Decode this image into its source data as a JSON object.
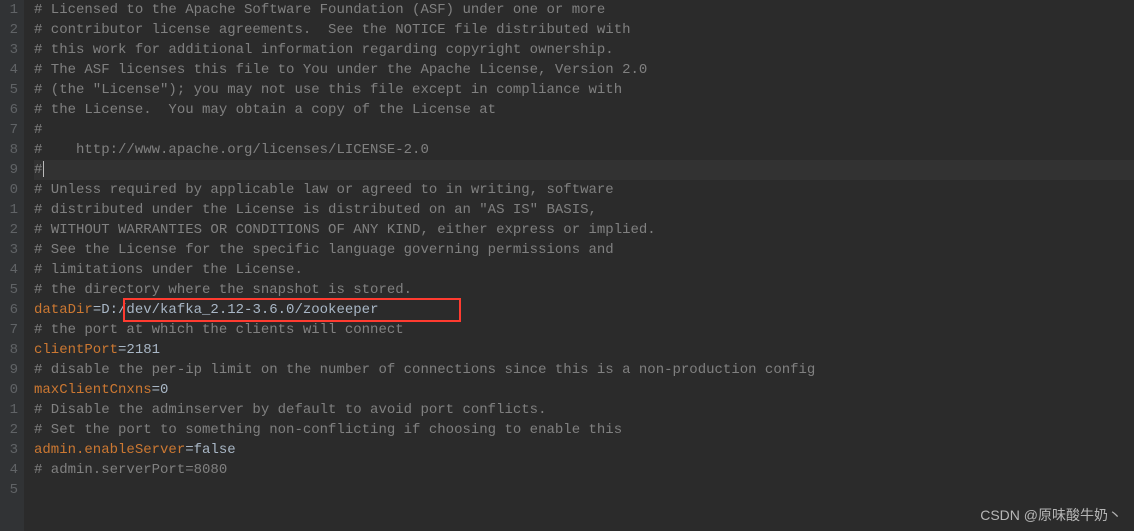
{
  "gutter": [
    "1",
    "2",
    "3",
    "4",
    "5",
    "6",
    "7",
    "8",
    "9",
    "0",
    "1",
    "2",
    "3",
    "4",
    "5",
    "6",
    "7",
    "8",
    "9",
    "0",
    "1",
    "2",
    "3",
    "4",
    "5"
  ],
  "lines": [
    {
      "type": "comment",
      "text": "# Licensed to the Apache Software Foundation (ASF) under one or more"
    },
    {
      "type": "comment",
      "text": "# contributor license agreements.  See the NOTICE file distributed with"
    },
    {
      "type": "comment",
      "text": "# this work for additional information regarding copyright ownership."
    },
    {
      "type": "comment",
      "text": "# The ASF licenses this file to You under the Apache License, Version 2.0"
    },
    {
      "type": "comment",
      "text": "# (the \"License\"); you may not use this file except in compliance with"
    },
    {
      "type": "comment",
      "text": "# the License.  You may obtain a copy of the License at"
    },
    {
      "type": "comment",
      "text": "#"
    },
    {
      "type": "comment",
      "text": "#    http://www.apache.org/licenses/LICENSE-2.0"
    },
    {
      "type": "comment",
      "text": "#",
      "current": true
    },
    {
      "type": "comment",
      "text": "# Unless required by applicable law or agreed to in writing, software"
    },
    {
      "type": "comment",
      "text": "# distributed under the License is distributed on an \"AS IS\" BASIS,"
    },
    {
      "type": "comment",
      "text": "# WITHOUT WARRANTIES OR CONDITIONS OF ANY KIND, either express or implied."
    },
    {
      "type": "comment",
      "text": "# See the License for the specific language governing permissions and"
    },
    {
      "type": "comment",
      "text": "# limitations under the License."
    },
    {
      "type": "comment",
      "text": "# the directory where the snapshot is stored."
    },
    {
      "type": "kv",
      "key": "dataDir",
      "value": "D:/dev/kafka_2.12-3.6.0/zookeeper"
    },
    {
      "type": "comment",
      "text": "# the port at which the clients will connect"
    },
    {
      "type": "kv",
      "key": "clientPort",
      "value": "2181"
    },
    {
      "type": "comment",
      "text": "# disable the per-ip limit on the number of connections since this is a non-production config"
    },
    {
      "type": "kv",
      "key": "maxClientCnxns",
      "value": "0"
    },
    {
      "type": "comment",
      "text": "# Disable the adminserver by default to avoid port conflicts."
    },
    {
      "type": "comment",
      "text": "# Set the port to something non-conflicting if choosing to enable this"
    },
    {
      "type": "kv",
      "key": "admin.enableServer",
      "value": "false"
    },
    {
      "type": "comment",
      "text": "# admin.serverPort=8080"
    },
    {
      "type": "blank",
      "text": ""
    }
  ],
  "watermark": "CSDN @原味酸牛奶丶"
}
